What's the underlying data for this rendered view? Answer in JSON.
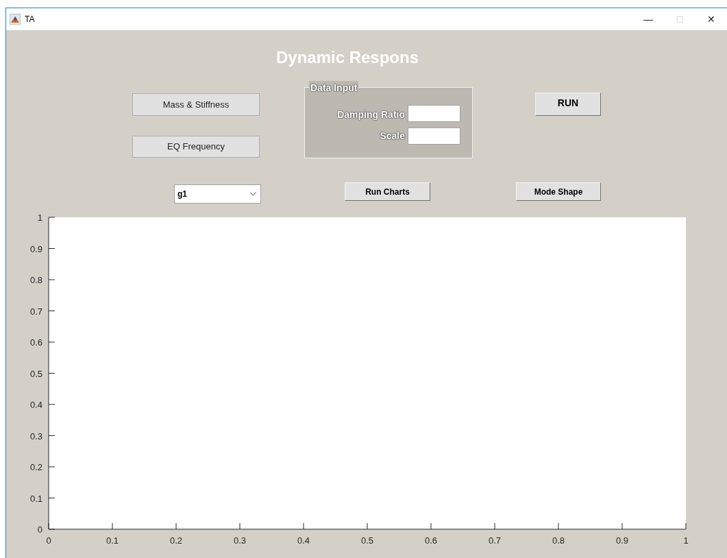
{
  "window": {
    "title": "TA",
    "controls": [
      "—",
      "□",
      "✕"
    ]
  },
  "heading": "Dynamic Respons",
  "buttons": [
    {
      "label": "Mass & Stiffness",
      "kind": "plain"
    },
    {
      "label": "EQ Frequency",
      "kind": "plain"
    },
    {
      "label": "RUN",
      "kind": "bold"
    },
    {
      "label": "Run Charts",
      "kind": "bold"
    },
    {
      "label": "Mode Shape",
      "kind": "bold"
    }
  ],
  "data_input": {
    "title": "Data Input",
    "fields": [
      {
        "label": "Damping Ratio"
      },
      {
        "label": "Scale"
      }
    ]
  },
  "dropdown": {
    "value": "g1"
  },
  "axes": {
    "chart_data": {
      "type": "line",
      "xlim": [
        0,
        1
      ],
      "ylim": [
        0,
        1
      ],
      "xticks": [
        {
          "value": 0,
          "label": "0"
        },
        {
          "value": 0.1,
          "label": "0.1"
        },
        {
          "value": 0.2,
          "label": "0.2"
        },
        {
          "value": 0.3,
          "label": "0.3"
        },
        {
          "value": 0.4,
          "label": "0.4"
        },
        {
          "value": 0.5,
          "label": "0.5"
        },
        {
          "value": 0.6,
          "label": "0.6"
        },
        {
          "value": 0.7,
          "label": "0.7"
        },
        {
          "value": 0.8,
          "label": "0.8"
        },
        {
          "value": 0.9,
          "label": "0.9"
        },
        {
          "value": 1,
          "label": "1"
        }
      ],
      "yticks": [
        {
          "value": 0,
          "label": "0"
        },
        {
          "value": 0.1,
          "label": "0.1"
        },
        {
          "value": 0.2,
          "label": "0.2"
        },
        {
          "value": 0.3,
          "label": "0.3"
        },
        {
          "value": 0.4,
          "label": "0.4"
        },
        {
          "value": 0.5,
          "label": "0.5"
        },
        {
          "value": 0.6,
          "label": "0.6"
        },
        {
          "value": 0.7,
          "label": "0.7"
        },
        {
          "value": 0.8,
          "label": "0.8"
        },
        {
          "value": 0.9,
          "label": "0.9"
        },
        {
          "value": 1,
          "label": "1"
        }
      ]
    }
  }
}
